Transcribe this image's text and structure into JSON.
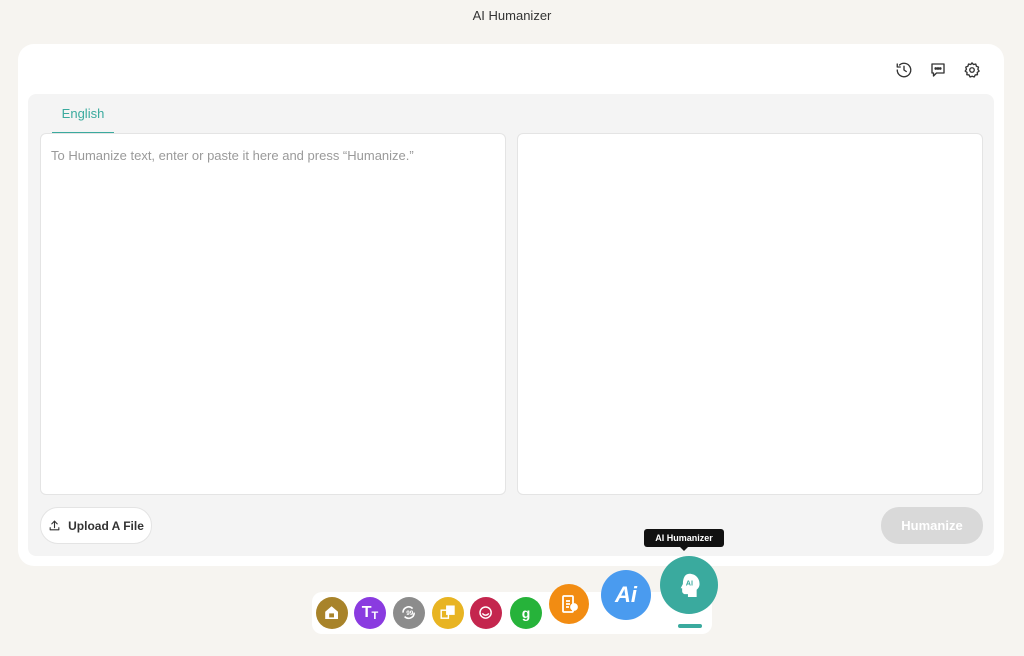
{
  "app": {
    "title": "AI Humanizer"
  },
  "toolbar": {
    "icons": [
      "history-icon",
      "feedback-icon",
      "settings-icon"
    ]
  },
  "tabs": [
    {
      "label": "English",
      "active": true
    }
  ],
  "input": {
    "placeholder": "To Humanize text, enter or paste it here and press “Humanize.”",
    "value": ""
  },
  "output": {
    "value": ""
  },
  "actions": {
    "upload_label": "Upload A File",
    "humanize_label": "Humanize"
  },
  "dock": {
    "tooltip": "AI Humanizer",
    "active_item": "ai-humanizer",
    "items": [
      {
        "name": "home",
        "color": "#a8832a"
      },
      {
        "name": "text-tool",
        "color": "#8a3be0",
        "glyph": "TT"
      },
      {
        "name": "paraphrase",
        "color": "#8c8c8c"
      },
      {
        "name": "translate",
        "color": "#e8b422"
      },
      {
        "name": "brand-tool",
        "color": "#c4264e"
      },
      {
        "name": "grammar",
        "color": "#26b33a",
        "glyph": "g"
      },
      {
        "name": "summarize",
        "color": "#f28c12"
      },
      {
        "name": "ai-detector",
        "color": "#4a9bef",
        "glyph": "Ai"
      },
      {
        "name": "ai-humanizer",
        "color": "#3aaa9e",
        "glyph": "AI"
      }
    ]
  },
  "colors": {
    "accent": "#3aaa9e",
    "background": "#f6f4f0"
  }
}
